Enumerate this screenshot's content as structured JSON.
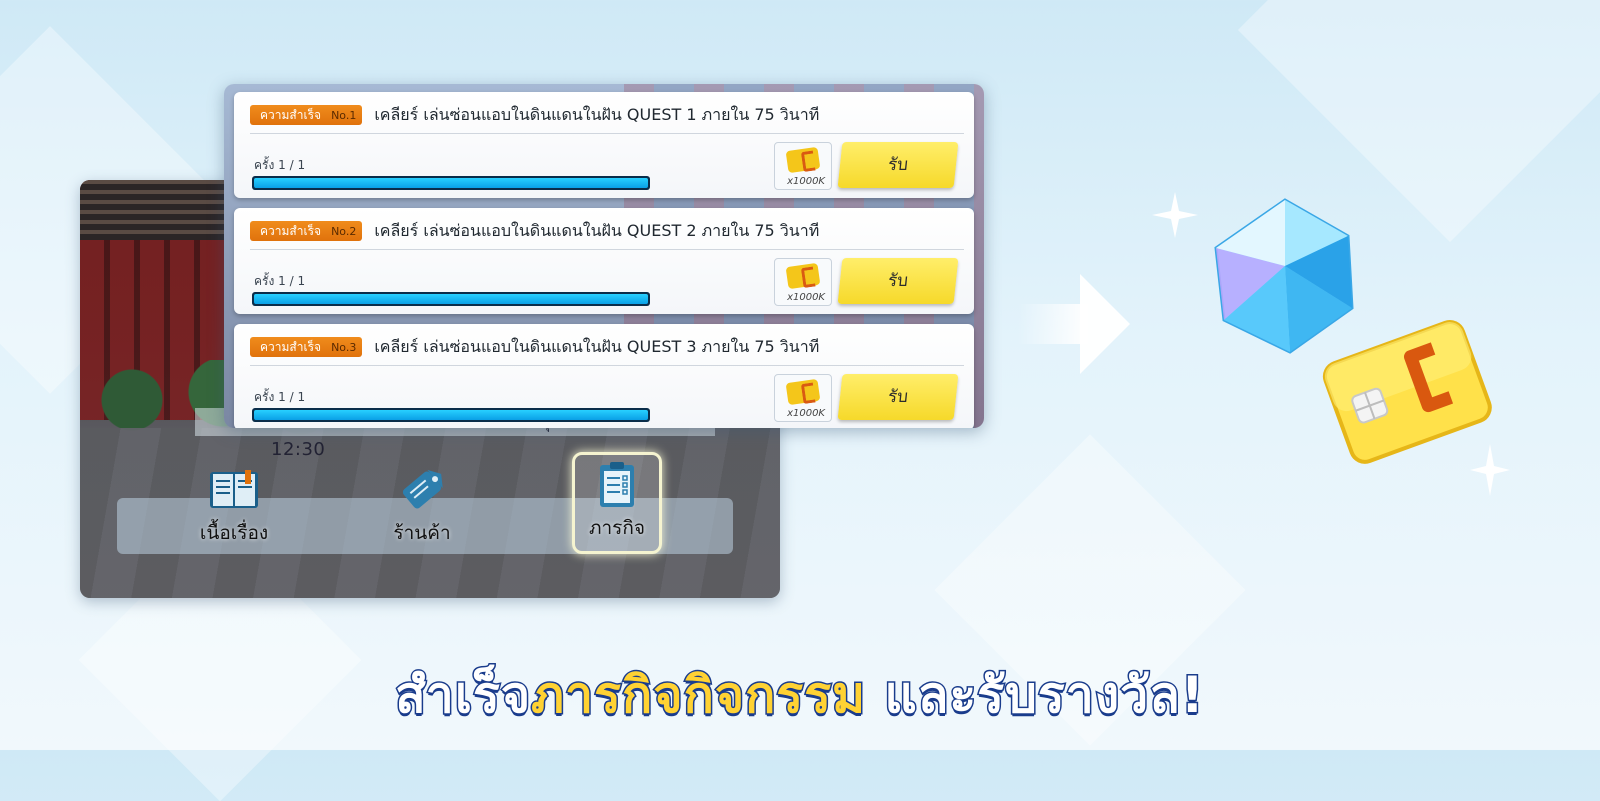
{
  "event": {
    "period_text": "ระยะเวลากิจกรรม : หลังปิดปรับปรุง - 2022.05.03 12:30"
  },
  "nav": [
    {
      "label": "เนื้อเรื่อง",
      "icon": "book-icon",
      "active": false
    },
    {
      "label": "ร้านค้า",
      "icon": "tag-icon",
      "active": false
    },
    {
      "label": "ภารกิจ",
      "icon": "clipboard-icon",
      "active": true
    }
  ],
  "quests": [
    {
      "badge": "ความสำเร็จ",
      "no": "No.1",
      "title": "เคลียร์ เล่นซ่อนแอบในดินแดนในฝัน QUEST 1 ภายใน 75 วินาที",
      "count": "ครั้ง 1 / 1",
      "progress": 1.0,
      "reward_qty": "x1000K",
      "claim_label": "รับ"
    },
    {
      "badge": "ความสำเร็จ",
      "no": "No.2",
      "title": "เคลียร์ เล่นซ่อนแอบในดินแดนในฝัน QUEST 2 ภายใน 75 วินาที",
      "count": "ครั้ง 1 / 1",
      "progress": 1.0,
      "reward_qty": "x1000K",
      "claim_label": "รับ"
    },
    {
      "badge": "ความสำเร็จ",
      "no": "No.3",
      "title": "เคลียร์ เล่นซ่อนแอบในดินแดนในฝัน QUEST 3 ภายใน 75 วินาที",
      "count": "ครั้ง 1 / 1",
      "progress": 1.0,
      "reward_qty": "x1000K",
      "claim_label": "รับ"
    }
  ],
  "caption": {
    "part1": "สำเร็จ",
    "part2": "ภารกิจกิจกรรม",
    "part3": " และรับรางวัล!"
  },
  "colors": {
    "accent_yellow": "#f6d92a",
    "badge_orange": "#e0720c",
    "progress_blue": "#0aa0e6",
    "caption_stroke": "#1a3c8c"
  }
}
